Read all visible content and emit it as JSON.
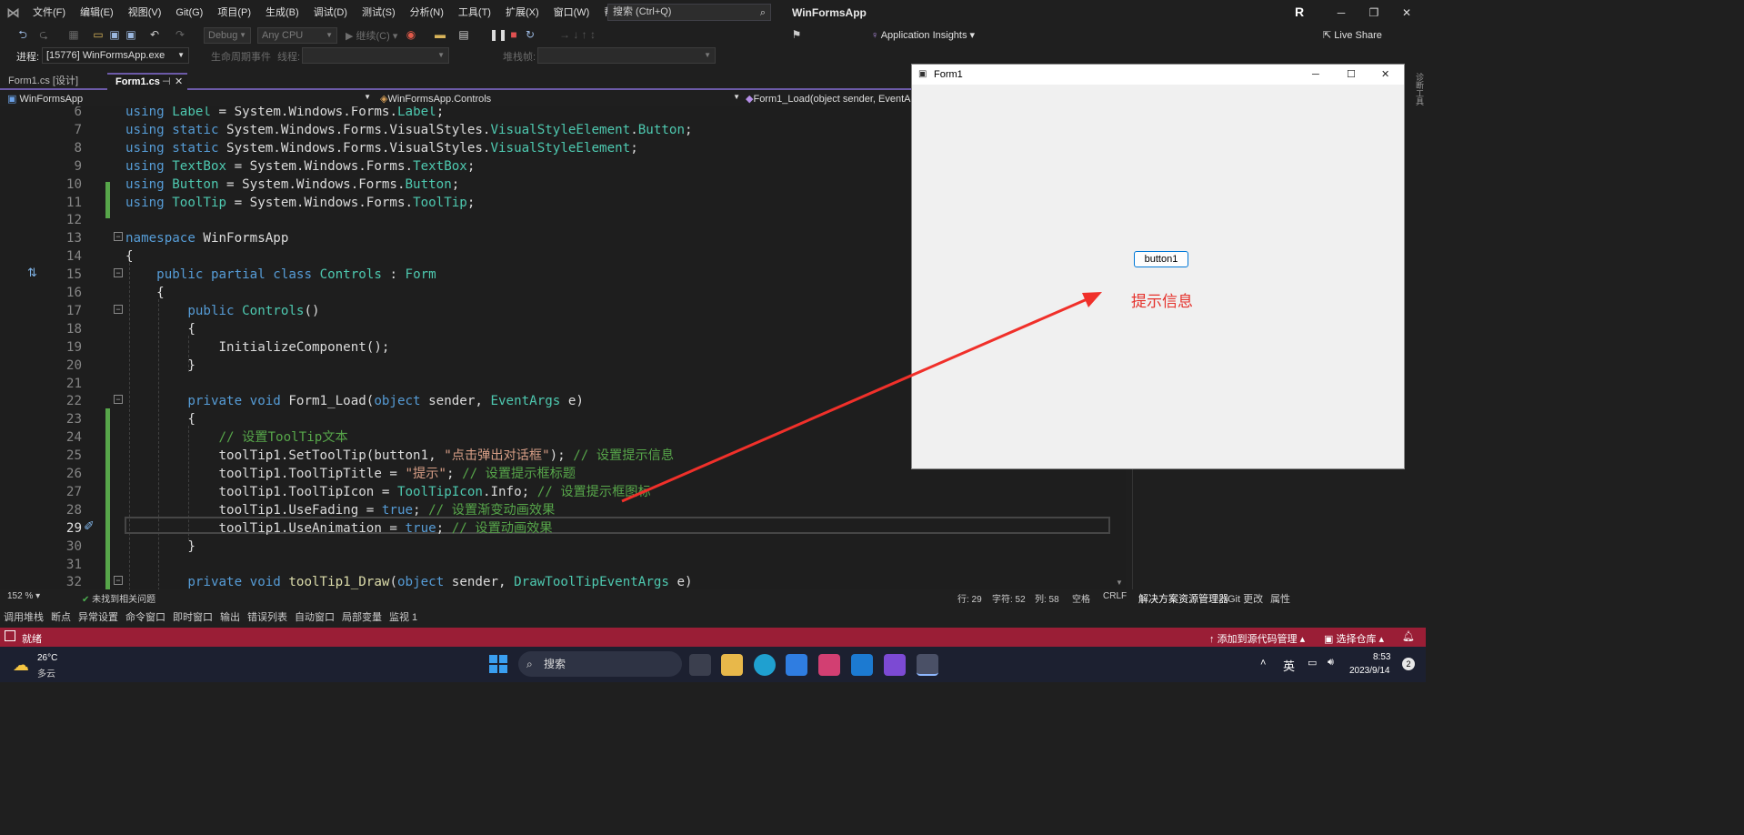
{
  "menubar": {
    "items": [
      "文件(F)",
      "编辑(E)",
      "视图(V)",
      "Git(G)",
      "项目(P)",
      "生成(B)",
      "调试(D)",
      "测试(S)",
      "分析(N)",
      "工具(T)",
      "扩展(X)",
      "窗口(W)",
      "帮助(H)"
    ],
    "search_placeholder": "搜索 (Ctrl+Q)",
    "app_title": "WinFormsApp",
    "account_initial": "R"
  },
  "toolbar": {
    "config": "Debug",
    "platform": "Any CPU",
    "continue_label": "继续(C)",
    "app_insights": "Application Insights",
    "live_share": "Live Share"
  },
  "toolbar2": {
    "process_label": "进程:",
    "process_value": "[15776] WinFormsApp.exe",
    "lifecycle_label": "生命周期事件",
    "thread_label": "线程:",
    "stackframe_label": "堆栈帧:"
  },
  "tabs": [
    {
      "label": "Form1.cs [设计]",
      "active": false
    },
    {
      "label": "Form1.cs",
      "active": true
    }
  ],
  "navbar": {
    "project": "WinFormsApp",
    "class": "WinFormsApp.Controls",
    "member": "Form1_Load(object sender, EventArgs e)"
  },
  "code_lines": [
    {
      "n": "6",
      "html": "<span class='kw'>using</span> <span class='ty'>Label</span><span class='pl'> = System.Windows.Forms.</span><span class='ty'>Label</span><span class='pl'>;</span>"
    },
    {
      "n": "7",
      "html": "<span class='kw'>using static</span><span class='pl'> System.Windows.Forms.VisualStyles.</span><span class='ty'>VisualStyleElement</span><span class='pl'>.</span><span class='ty'>Button</span><span class='pl'>;</span>"
    },
    {
      "n": "8",
      "html": "<span class='kw'>using static</span><span class='pl'> System.Windows.Forms.VisualStyles.</span><span class='ty'>VisualStyleElement</span><span class='pl'>;</span>"
    },
    {
      "n": "9",
      "html": "<span class='kw'>using</span> <span class='ty'>TextBox</span><span class='pl'> = System.Windows.Forms.</span><span class='ty'>TextBox</span><span class='pl'>;</span>"
    },
    {
      "n": "10",
      "html": "<span class='kw'>using</span> <span class='ty'>Button</span><span class='pl'> = System.Windows.Forms.</span><span class='ty'>Button</span><span class='pl'>;</span>"
    },
    {
      "n": "11",
      "html": "<span class='kw'>using</span> <span class='ty'>ToolTip</span><span class='pl'> = System.Windows.Forms.</span><span class='ty'>ToolTip</span><span class='pl'>;</span>"
    },
    {
      "n": "12",
      "html": ""
    },
    {
      "n": "13",
      "html": "<span class='kw'>namespace</span><span class='pl'> WinFormsApp</span>"
    },
    {
      "n": "14",
      "html": "<span class='pl'>{</span>"
    },
    {
      "n": "15",
      "html": "<span class='pl'>    </span><span class='kw'>public partial class</span> <span class='ty'>Controls</span><span class='pl'> : </span><span class='ty'>Form</span>"
    },
    {
      "n": "16",
      "html": "<span class='pl'>    {</span>"
    },
    {
      "n": "17",
      "html": "<span class='pl'>        </span><span class='kw'>public</span> <span class='ty'>Controls</span><span class='pl'>()</span>"
    },
    {
      "n": "18",
      "html": "<span class='pl'>        {</span>"
    },
    {
      "n": "19",
      "html": "<span class='pl'>            InitializeComponent();</span>"
    },
    {
      "n": "20",
      "html": "<span class='pl'>        }</span>"
    },
    {
      "n": "21",
      "html": ""
    },
    {
      "n": "22",
      "html": "<span class='pl'>        </span><span class='kw'>private void</span><span class='pl'> Form1_Load(</span><span class='kw'>object</span><span class='pl'> sender, </span><span class='ty'>EventArgs</span><span class='pl'> e)</span>"
    },
    {
      "n": "23",
      "html": "<span class='pl'>        {</span>"
    },
    {
      "n": "24",
      "html": "<span class='pl'>            </span><span class='cm'>// 设置ToolTip文本</span>"
    },
    {
      "n": "25",
      "html": "<span class='pl'>            toolTip1.SetToolTip(button1, </span><span class='st'>\"点击弹出对话框\"</span><span class='pl'>); </span><span class='cm'>// 设置提示信息</span>"
    },
    {
      "n": "26",
      "html": "<span class='pl'>            toolTip1.ToolTipTitle = </span><span class='st'>\"提示\"</span><span class='pl'>; </span><span class='cm'>// 设置提示框标题</span>"
    },
    {
      "n": "27",
      "html": "<span class='pl'>            toolTip1.ToolTipIcon = </span><span class='ty'>ToolTipIcon</span><span class='pl'>.Info; </span><span class='cm'>// 设置提示框图标</span>"
    },
    {
      "n": "28",
      "html": "<span class='pl'>            toolTip1.UseFading = </span><span class='kw'>true</span><span class='pl'>; </span><span class='cm'>// 设置渐变动画效果</span>"
    },
    {
      "n": "29",
      "html": "<span class='pl'>            toolTip1.UseAnimation = </span><span class='kw'>true</span><span class='pl'>; </span><span class='cm'>// 设置动画效果</span>"
    },
    {
      "n": "30",
      "html": "<span class='pl'>        }</span>"
    },
    {
      "n": "31",
      "html": ""
    },
    {
      "n": "32",
      "html": "<span class='pl'>        </span><span class='kw'>private void</span><span class='pl'> </span><span class='fn'>toolTip1_Draw</span><span class='pl'>(</span><span class='kw'>object</span><span class='pl'> sender, </span><span class='ty'>DrawToolTipEventArgs</span><span class='pl'> e)</span>"
    }
  ],
  "form1": {
    "title": "Form1",
    "button_label": "button1",
    "annotation": "提示信息"
  },
  "editor_status": {
    "zoom": "152 %",
    "issues": "未找到相关问题",
    "line": "行: 29",
    "char": "字符: 52",
    "col": "列: 58",
    "whitespace": "空格",
    "eol": "CRLF"
  },
  "right_tabs": [
    "解决方案资源管理器",
    "Git 更改",
    "属性"
  ],
  "bottom_tabs": [
    "调用堆栈",
    "断点",
    "异常设置",
    "命令窗口",
    "即时窗口",
    "输出",
    "错误列表",
    "自动窗口",
    "局部变量",
    "监视 1"
  ],
  "statusbar": {
    "ready": "就绪",
    "source_control": "添加到源代码管理",
    "repo": "选择仓库",
    "notifications": "2"
  },
  "taskbar": {
    "weather_temp": "26°C",
    "weather_desc": "多云",
    "search": "搜索",
    "ime": "英",
    "time": "8:53",
    "date": "2023/9/14"
  },
  "colors": {
    "accent": "#6c5aa8",
    "status_bar": "#9a1e36",
    "annotation_red": "#e5312b"
  }
}
